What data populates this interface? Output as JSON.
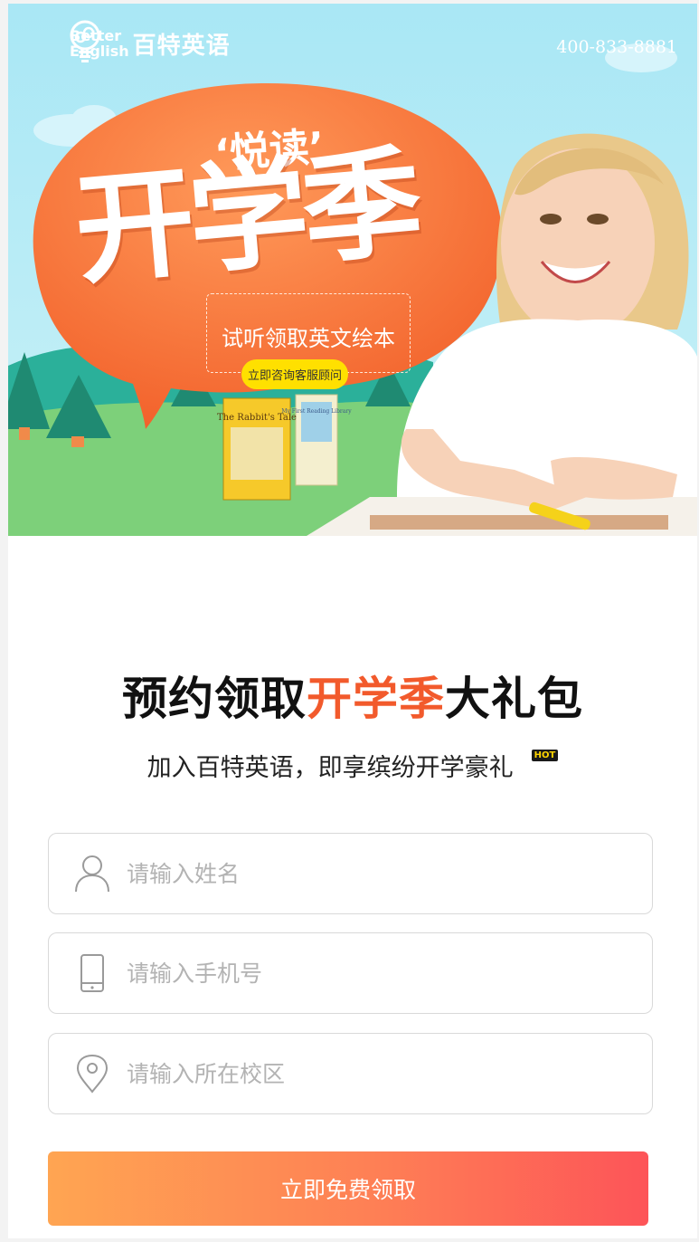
{
  "header": {
    "logo_en": "Better\nEnglish",
    "logo_cn": "百特英语",
    "phone": "400-833-8881"
  },
  "banner": {
    "title_small": "‘悦读’",
    "title_big": "开学季",
    "trial_text": "试听领取英文绘本",
    "consult_button": "立即咨询客服顾问",
    "book1_title": "The Rabbit's Tale",
    "book2_title": "My First Reading Library"
  },
  "promo": {
    "headline_before": "预约领取",
    "headline_accent": "开学季",
    "headline_after": "大礼包",
    "subtitle": "加入百特英语，即享缤纷开学豪礼",
    "hot_badge": "HOT",
    "accent_color": "#f25a2c"
  },
  "form": {
    "name_placeholder": "请输入姓名",
    "phone_placeholder": "请输入手机号",
    "campus_placeholder": "请输入所在校区",
    "submit_label": "立即免费领取",
    "icons": [
      "user-icon",
      "phone-icon",
      "location-pin-icon"
    ]
  }
}
